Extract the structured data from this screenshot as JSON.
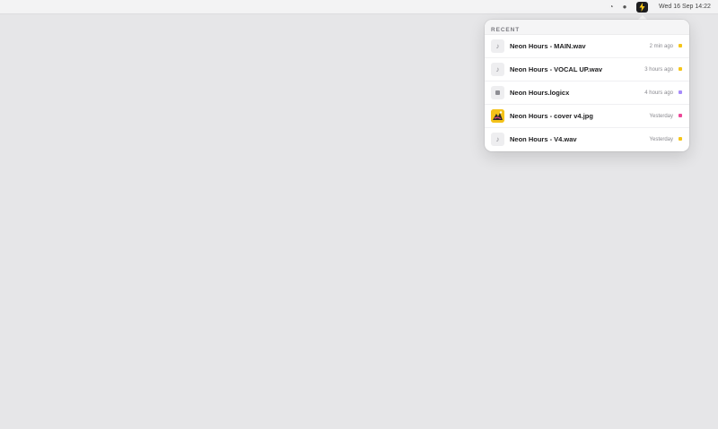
{
  "menubar": {
    "clock_icon": "clock-icon",
    "drop_icon": "droplet-icon",
    "active_icon": "bolt-icon",
    "datetime": "Wed 16 Sep 14:22"
  },
  "popover": {
    "header": "RECENT",
    "items": [
      {
        "name": "Neon Hours - MAIN.wav",
        "time": "2 min ago",
        "thumb": "♪",
        "icon": "audio-file-icon",
        "tag_color": "#f5c518"
      },
      {
        "name": "Neon Hours - VOCAL UP.wav",
        "time": "3 hours ago",
        "thumb": "♪",
        "icon": "audio-file-icon",
        "tag_color": "#f5c518"
      },
      {
        "name": "Neon Hours.logicx",
        "time": "4 hours ago",
        "thumb": "",
        "icon": "project-file-icon",
        "tag_color": "#a78bfa"
      },
      {
        "name": "Neon Hours - cover v4.jpg",
        "time": "Yesterday",
        "thumb": "",
        "icon": "image-thumbnail",
        "tag_color": "#ec4899"
      },
      {
        "name": "Neon Hours - V4.wav",
        "time": "Yesterday",
        "thumb": "♪",
        "icon": "audio-file-icon",
        "tag_color": "#f5c518"
      }
    ]
  }
}
